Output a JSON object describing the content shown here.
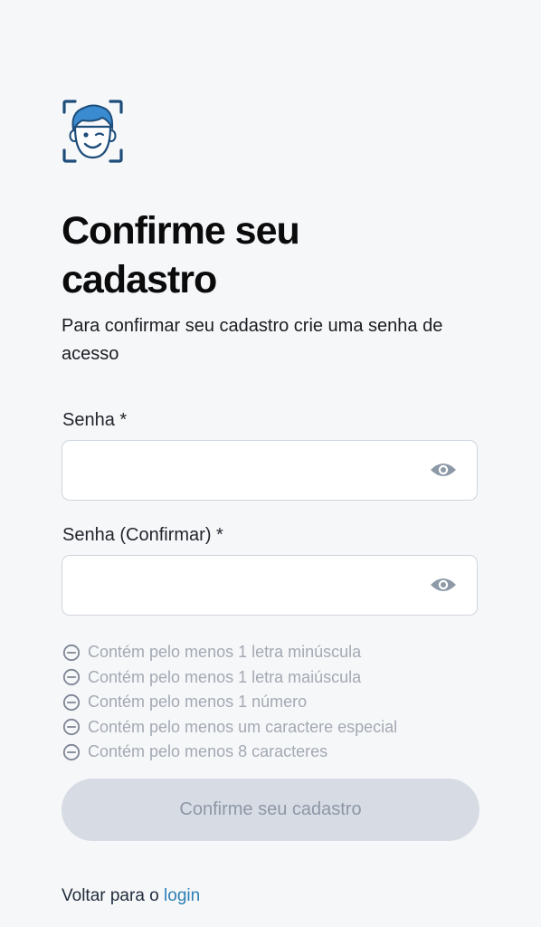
{
  "colors": {
    "background": "#f6f7f9",
    "accent": "#2b7fb6",
    "logo_navy": "#1d4d7a",
    "disabled_button_bg": "#d7dce4",
    "rule_text": "#a3a9b3"
  },
  "logo": {
    "icon": "face-scan-icon"
  },
  "header": {
    "title": "Confirme seu cadastro",
    "subtitle": "Para confirmar seu cadastro crie uma senha de acesso"
  },
  "form": {
    "password": {
      "label": "Senha *",
      "value": "",
      "placeholder": "",
      "toggle_icon": "eye-icon"
    },
    "password_confirm": {
      "label": "Senha (Confirmar) *",
      "value": "",
      "placeholder": "",
      "toggle_icon": "eye-icon"
    },
    "rules": [
      {
        "text": "Contém pelo menos 1 letra minúscula",
        "icon": "minus-circle-icon"
      },
      {
        "text": "Contém pelo menos 1 letra maiúscula",
        "icon": "minus-circle-icon"
      },
      {
        "text": "Contém pelo menos 1 número",
        "icon": "minus-circle-icon"
      },
      {
        "text": "Contém pelo menos um caractere especial",
        "icon": "minus-circle-icon"
      },
      {
        "text": "Contém pelo menos 8 caracteres",
        "icon": "minus-circle-icon"
      }
    ],
    "submit_label": "Confirme seu cadastro"
  },
  "footer": {
    "back_prefix": "Voltar para o",
    "back_link": "login"
  }
}
